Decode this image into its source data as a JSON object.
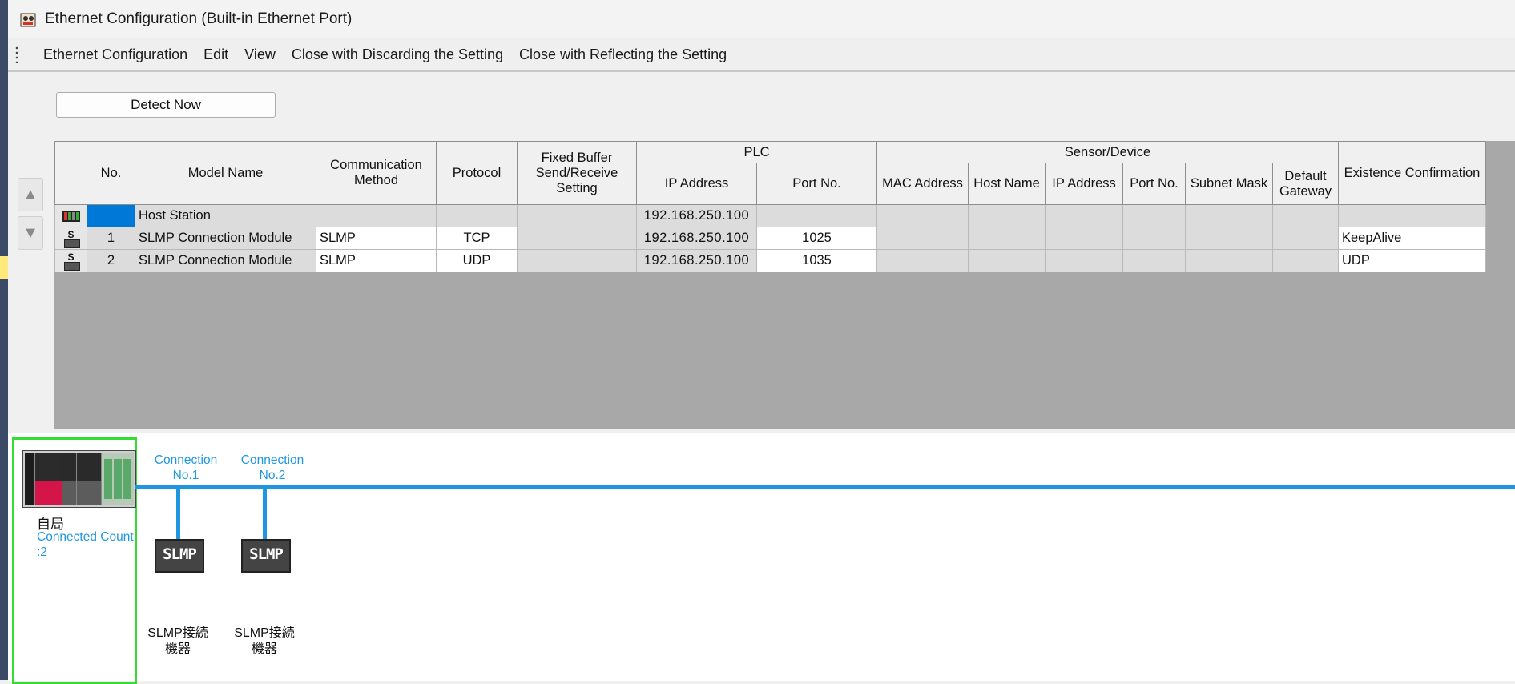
{
  "window": {
    "title": "Ethernet Configuration (Built-in Ethernet Port)",
    "icon": "app-config-icon"
  },
  "menu": [
    "Ethernet Configuration",
    "Edit",
    "View",
    "Close with Discarding the Setting",
    "Close with Reflecting the Setting"
  ],
  "toolbar": {
    "detect_label": "Detect Now"
  },
  "nav": {
    "up": "▲",
    "down": "▼"
  },
  "table": {
    "headers": {
      "no": "No.",
      "model": "Model Name",
      "comm": "Communication Method",
      "protocol": "Protocol",
      "fixed": "Fixed Buffer Send/Receive Setting",
      "plc_group": "PLC",
      "plc_ip": "IP Address",
      "plc_port": "Port No.",
      "sensor_group": "Sensor/Device",
      "mac": "MAC Address",
      "host": "Host Name",
      "dev_ip": "IP Address",
      "dev_port": "Port No.",
      "subnet": "Subnet Mask",
      "gateway": "Default Gateway",
      "existence": "Existence Confirmation"
    },
    "rows": [
      {
        "icon": "host-station-icon",
        "no": "",
        "model": "Host Station",
        "comm": "",
        "protocol": "",
        "fixed": "",
        "plc_ip": "192.168.250.100",
        "plc_port": "",
        "mac": "",
        "host": "",
        "dev_ip": "",
        "dev_port": "",
        "subnet": "",
        "gateway": "",
        "existence": ""
      },
      {
        "icon": "slmp-device-icon",
        "no": "1",
        "model": "SLMP Connection Module",
        "comm": "SLMP",
        "protocol": "TCP",
        "fixed": "",
        "plc_ip": "192.168.250.100",
        "plc_port": "1025",
        "mac": "",
        "host": "",
        "dev_ip": "",
        "dev_port": "",
        "subnet": "",
        "gateway": "",
        "existence": "KeepAlive"
      },
      {
        "icon": "slmp-device-icon",
        "no": "2",
        "model": "SLMP Connection Module",
        "comm": "SLMP",
        "protocol": "UDP",
        "fixed": "",
        "plc_ip": "192.168.250.100",
        "plc_port": "1035",
        "mac": "",
        "host": "",
        "dev_ip": "",
        "dev_port": "",
        "subnet": "",
        "gateway": "",
        "existence": "UDP"
      }
    ]
  },
  "network": {
    "station_label": "自局",
    "connected_count_label": "Connected Count",
    "connected_count_value": ":2",
    "connections": [
      {
        "label_line1": "Connection",
        "label_line2": "No.1",
        "device_badge": "SLMP",
        "device_line1": "SLMP接続",
        "device_line2": "機器"
      },
      {
        "label_line1": "Connection",
        "label_line2": "No.2",
        "device_badge": "SLMP",
        "device_line1": "SLMP接続",
        "device_line2": "機器"
      }
    ],
    "colors": {
      "bus": "#1e96e0",
      "station_border": "#33dd33"
    }
  }
}
